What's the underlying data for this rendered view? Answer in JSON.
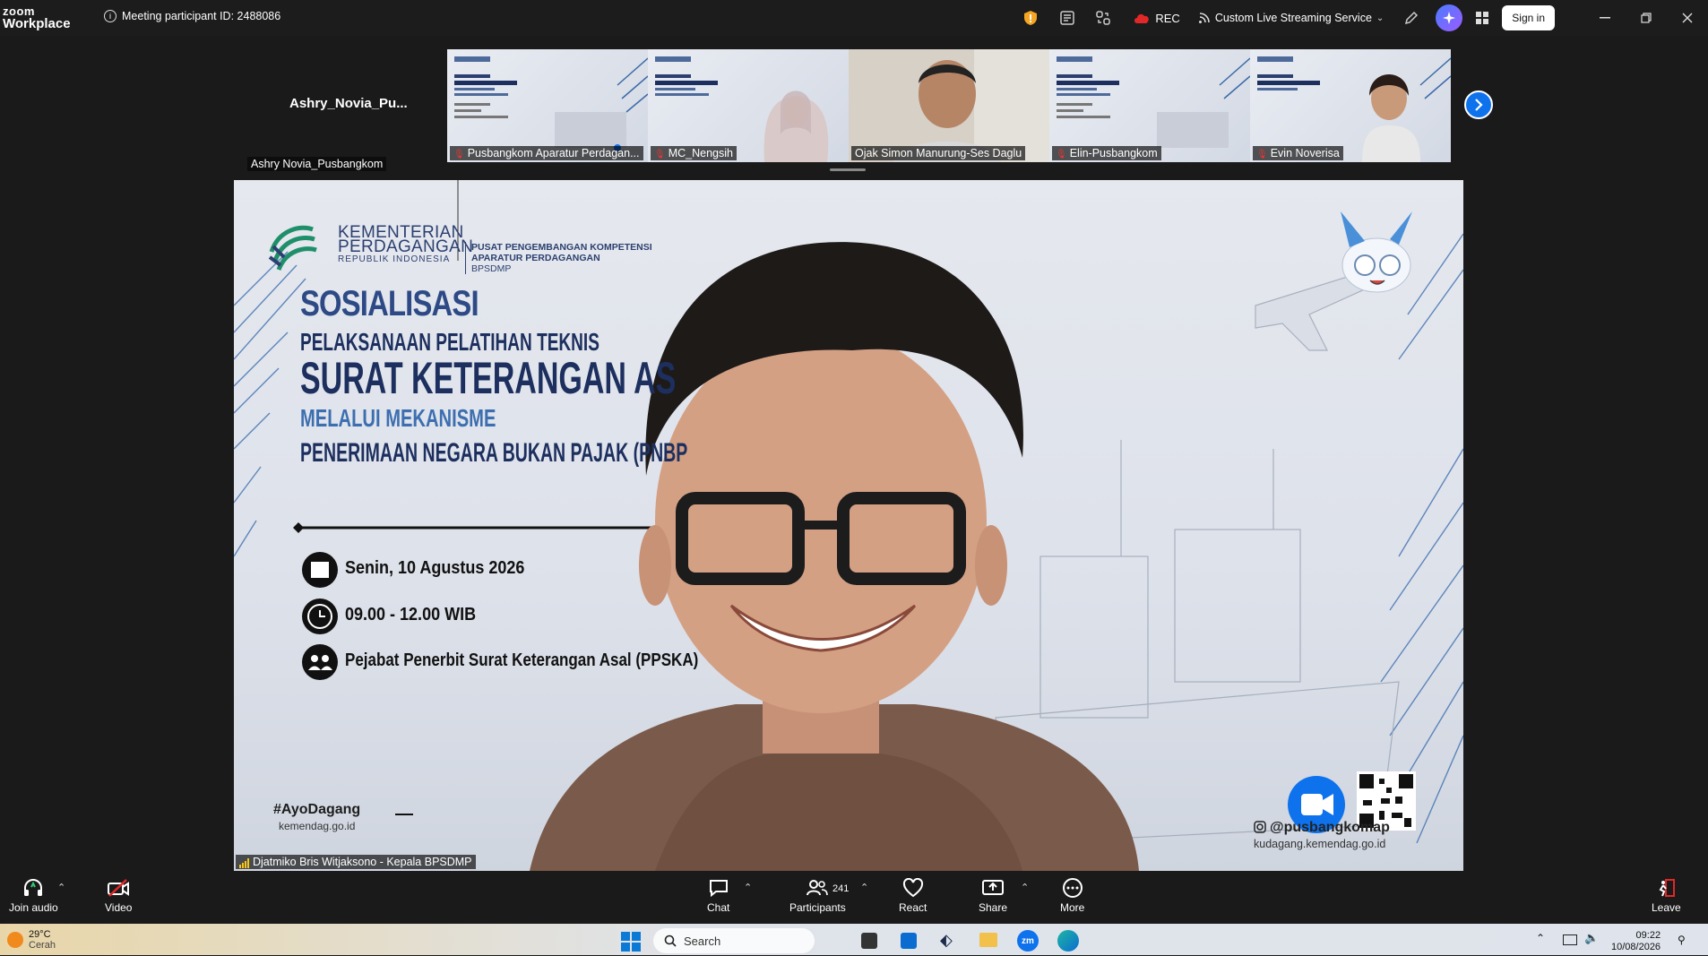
{
  "app": {
    "name_line1": "zoom",
    "name_line2": "Workplace"
  },
  "meeting": {
    "participant_id_text": "Meeting participant ID: 2488086"
  },
  "toolbar_top": {
    "rec_label": "REC",
    "streaming_label": "Custom Live Streaming Service",
    "signin_label": "Sign in"
  },
  "gallery": {
    "self_name_large": "Ashry_Novia_Pu...",
    "self_name_label": "Ashry Novia_Pusbangkom",
    "tiles": [
      {
        "name": "Pusbangkom Aparatur Perdagan...",
        "muted": true
      },
      {
        "name": "MC_Nengsih",
        "muted": true
      },
      {
        "name": "Ojak Simon Manurung-Ses Daglu",
        "muted": false
      },
      {
        "name": "Elin-Pusbangkom",
        "muted": true
      },
      {
        "name": "Evin Noverisa",
        "muted": true
      }
    ]
  },
  "slide": {
    "ministry_line1": "KEMENTERIAN",
    "ministry_line2": "PERDAGANGAN",
    "ministry_line3": "REPUBLIK INDONESIA",
    "center_line1": "PUSAT PENGEMBANGAN KOMPETENSI",
    "center_line2": "APARATUR PERDAGANGAN",
    "center_line3": "BPSDMP",
    "title1": "SOSIALISASI",
    "title2": "PELAKSANAAN PELATIHAN TEKNIS",
    "title3": "SURAT KETERANGAN AS",
    "title4": "MELALUI MEKANISME",
    "title5": "PENERIMAAN NEGARA BUKAN PAJAK (PNBP",
    "date": "Senin, 10 Agustus 2026",
    "time": "09.00 - 12.00 WIB",
    "audience": "Pejabat Penerbit Surat Keterangan Asal (PPSKA)",
    "hashtag": "#AyoDagang",
    "site1": "kemendag.go.id",
    "social": "@pusbangkomap",
    "site2": "kudagang.kemendag.go.id"
  },
  "speaker": {
    "name": "Djatmiko Bris Witjaksono - Kepala BPSDMP"
  },
  "bottom_bar": {
    "join_audio": "Join audio",
    "video": "Video",
    "chat": "Chat",
    "participants": "Participants",
    "participants_count": "241",
    "react": "React",
    "share": "Share",
    "more": "More",
    "leave": "Leave"
  },
  "taskbar": {
    "temp": "29°C",
    "weather": "Cerah",
    "search_placeholder": "Search",
    "time": "09:22",
    "date": "10/08/2026"
  },
  "colors": {
    "accent_blue": "#0e72ed",
    "mute_red": "#e02828",
    "slide_navy": "#1c2f5e",
    "rec_red": "#e02828"
  }
}
